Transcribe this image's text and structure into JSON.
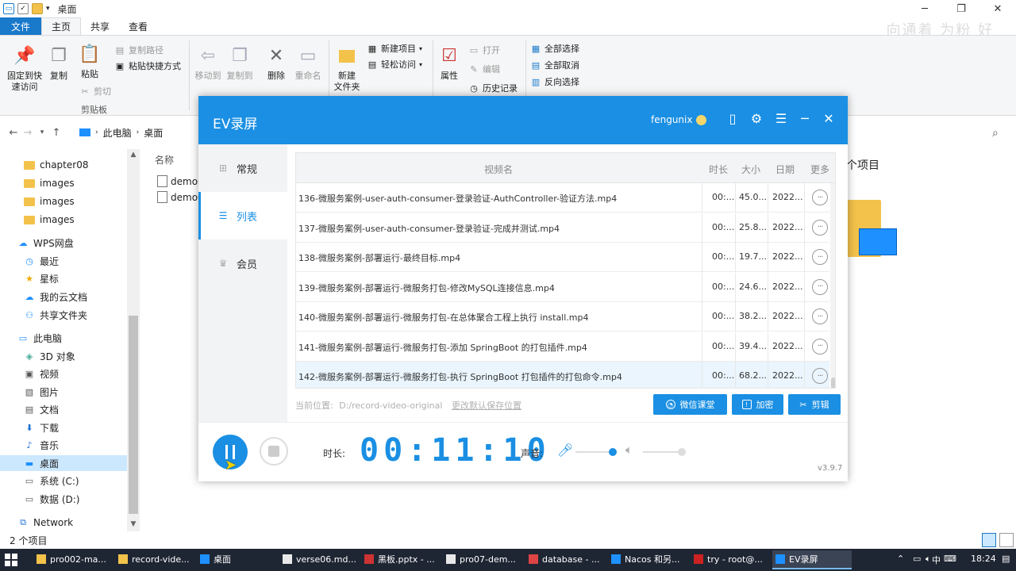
{
  "explorer": {
    "title": "桌面",
    "tabs": {
      "file": "文件",
      "home": "主页",
      "share": "共享",
      "view": "查看"
    },
    "watermark": "向通着 为粉 好",
    "ribbon": {
      "pin": "固定到快\n速访问",
      "copy": "复制",
      "paste": "粘贴",
      "copy_path": "复制路径",
      "paste_shortcut": "粘贴快捷方式",
      "cut": "剪切",
      "clipboard_group": "剪贴板",
      "move_to": "移动到",
      "copy_to": "复制到",
      "delete": "删除",
      "rename": "重命名",
      "new_folder": "新建\n文件夹",
      "new_item": "新建项目",
      "easy_access": "轻松访问",
      "properties": "属性",
      "open": "打开",
      "edit": "编辑",
      "history": "历史记录",
      "select_all": "全部选择",
      "select_none": "全部取消",
      "invert": "反向选择"
    },
    "address": {
      "pc": "此电脑",
      "desktop": "桌面"
    },
    "sidebar": [
      {
        "label": "chapter08",
        "type": "folder"
      },
      {
        "label": "images",
        "type": "folder"
      },
      {
        "label": "images",
        "type": "folder"
      },
      {
        "label": "images",
        "type": "folder"
      },
      {
        "label": "WPS网盘",
        "type": "cloud"
      },
      {
        "label": "最近",
        "type": "clock"
      },
      {
        "label": "星标",
        "type": "star"
      },
      {
        "label": "我的云文档",
        "type": "cloud"
      },
      {
        "label": "共享文件夹",
        "type": "share"
      },
      {
        "label": "此电脑",
        "type": "pc"
      },
      {
        "label": "3D 对象",
        "type": "cube"
      },
      {
        "label": "视频",
        "type": "video"
      },
      {
        "label": "图片",
        "type": "image"
      },
      {
        "label": "文档",
        "type": "doc"
      },
      {
        "label": "下载",
        "type": "download"
      },
      {
        "label": "音乐",
        "type": "music"
      },
      {
        "label": "桌面",
        "type": "desktop"
      },
      {
        "label": "系统 (C:)",
        "type": "drive"
      },
      {
        "label": "数据 (D:)",
        "type": "drive"
      },
      {
        "label": "Network",
        "type": "network"
      }
    ],
    "content": {
      "name_header": "名称",
      "files": [
        "demo0",
        "demo0"
      ],
      "right_text": "个项目"
    },
    "status": "2 个项目"
  },
  "ev": {
    "title": "EV录屏",
    "user": "fengunix",
    "nav": {
      "general": "常规",
      "list": "列表",
      "member": "会员"
    },
    "table_headers": {
      "name": "视频名",
      "duration": "时长",
      "size": "大小",
      "date": "日期",
      "more": "更多"
    },
    "rows": [
      {
        "name": "136-微服务案例-user-auth-consumer-登录验证-AuthController-验证方法.mp4",
        "duration": "00:...",
        "size": "45.0...",
        "date": "2022..."
      },
      {
        "name": "137-微服务案例-user-auth-consumer-登录验证-完成并测试.mp4",
        "duration": "00:...",
        "size": "25.8...",
        "date": "2022..."
      },
      {
        "name": "138-微服务案例-部署运行-最终目标.mp4",
        "duration": "00:...",
        "size": "19.7...",
        "date": "2022..."
      },
      {
        "name": "139-微服务案例-部署运行-微服务打包-修改MySQL连接信息.mp4",
        "duration": "00:...",
        "size": "24.6...",
        "date": "2022..."
      },
      {
        "name": "140-微服务案例-部署运行-微服务打包-在总体聚合工程上执行 install.mp4",
        "duration": "00:...",
        "size": "38.2...",
        "date": "2022..."
      },
      {
        "name": "141-微服务案例-部署运行-微服务打包-添加 SpringBoot 的打包插件.mp4",
        "duration": "00:...",
        "size": "39.4...",
        "date": "2022..."
      },
      {
        "name": "142-微服务案例-部署运行-微服务打包-执行 SpringBoot 打包插件的打包命令.mp4",
        "duration": "00:...",
        "size": "68.2...",
        "date": "2022..."
      }
    ],
    "location_label": "当前位置:",
    "location_path": "D:/record-video-original",
    "change_location": "更改默认保存位置",
    "buttons": {
      "wechat": "微信课堂",
      "encrypt": "加密",
      "edit": "剪辑"
    },
    "duration_label": "时长:",
    "timer": "00:11:10",
    "sound_label": "声音:",
    "version": "v3.9.7"
  },
  "taskbar": {
    "items": [
      "pro002-ma...",
      "record-vide...",
      "桌面",
      "verse06.md...",
      "黑板.pptx - ...",
      "pro07-dem...",
      "database - ...",
      "Nacos 和另...",
      "try - root@...",
      "EV录屏"
    ],
    "ime": "中",
    "time": "18:24"
  }
}
